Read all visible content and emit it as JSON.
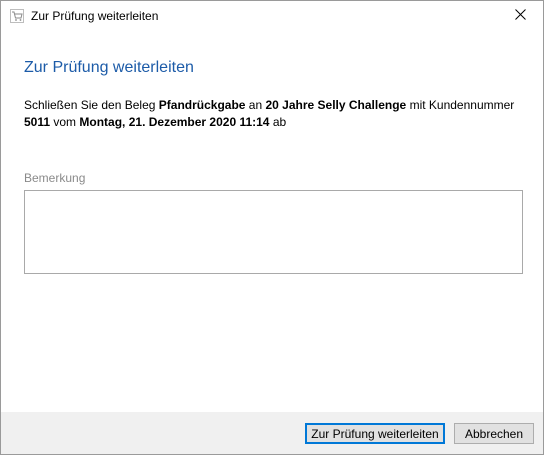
{
  "window": {
    "title": "Zur Prüfung weiterleiten",
    "app_icon": "cart-icon",
    "close_icon": "close-icon"
  },
  "dialog": {
    "heading": "Zur Prüfung weiterleiten",
    "message": {
      "part1": "Schließen Sie den Beleg ",
      "document_type": "Pfandrückgabe",
      "part2": " an ",
      "challenge": "20 Jahre Selly Challenge",
      "part3": " mit Kundennummer ",
      "customer_number": "5011",
      "part4": " vom ",
      "datetime": "Montag, 21. Dezember 2020 11:14",
      "part5": " ab"
    },
    "remark": {
      "label": "Bemerkung",
      "value": ""
    }
  },
  "buttons": {
    "submit_label": "Zur Prüfung weiterleiten",
    "cancel_label": "Abbrechen"
  }
}
